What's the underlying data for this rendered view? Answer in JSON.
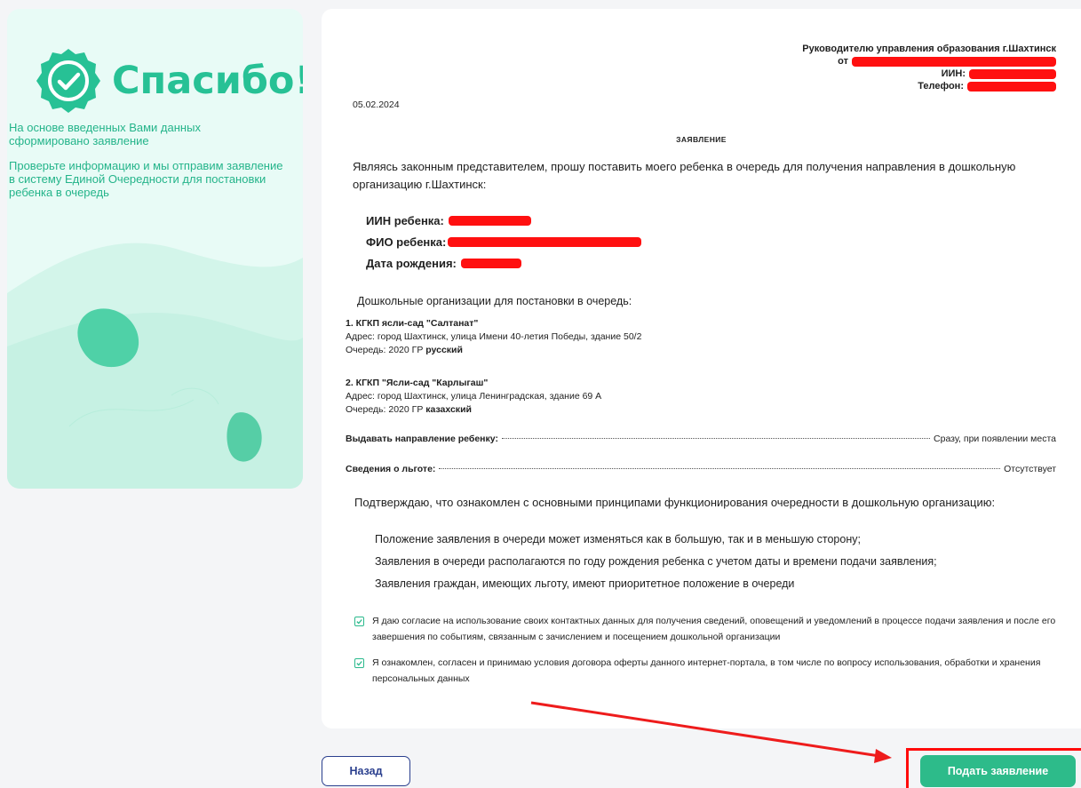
{
  "left_panel": {
    "title": "Спасибо!",
    "text1": "На основе введенных Вами данных сформировано заявление",
    "text2": "Проверьте информацию и мы отправим заявление в систему Единой Очередности для постановки ребенка в очередь"
  },
  "document": {
    "addressee_line": "Руководителю управления образования г.Шахтинск",
    "from_label": "от",
    "iin_label": "ИИН:",
    "phone_label": "Телефон:",
    "date": "05.02.2024",
    "title": "ЗАЯВЛЕНИЕ",
    "intro": "Являясь законным представителем, прошу поставить моего ребенка в очередь для получения направления в дошкольную организацию г.Шахтинск:",
    "child_iin_label": "ИИН ребенка:",
    "child_name_label": "ФИО ребенка:",
    "child_birth_label": "Дата рождения:",
    "orgs_heading": "Дошкольные организации для постановки в очередь:",
    "orgs": [
      {
        "name": "1. КГКП ясли-сад \"Салтанат\"",
        "address": "Адрес: город Шахтинск, улица Имени 40-летия Победы, здание 50/2",
        "queue_prefix": "Очередь: 2020 ГР",
        "queue_lang": "русский"
      },
      {
        "name": "2. КГКП \"Ясли-сад \"Карлыгаш\"",
        "address": "Адрес: город Шахтинск, улица Ленинградская, здание 69 А",
        "queue_prefix": "Очередь: 2020 ГР",
        "queue_lang": "казахский"
      }
    ],
    "referral_label": "Выдавать направление ребенку:",
    "referral_value": "Сразу, при появлении места",
    "benefit_label": "Сведения о льготе:",
    "benefit_value": "Отсутствует",
    "confirm_heading": "Подтверждаю, что ознакомлен с основными принципами функционирования очередности в дошкольную организацию:",
    "principles": [
      "Положение заявления в очереди может изменяться как в большую, так и в меньшую сторону;",
      "Заявления в очереди располагаются по году рождения ребенка с учетом даты и времени подачи заявления;",
      "Заявления граждан, имеющих льготу, имеют приоритетное положение в очереди"
    ],
    "consent1": "Я даю согласие на использование своих контактных данных для получения сведений, оповещений и уведомлений в процессе подачи заявления и после его завершения по событиям, связанным с зачислением и посещением дошкольной организации",
    "consent2": "Я ознакомлен, согласен и принимаю условия договора оферты данного интернет-портала, в том числе по вопросу использования, обработки и хранения персональных данных"
  },
  "buttons": {
    "back": "Назад",
    "submit": "Подать заявление"
  },
  "colors": {
    "accent": "#2dbb8a",
    "back_border": "#2a3f8e",
    "redaction": "#ff1010"
  }
}
